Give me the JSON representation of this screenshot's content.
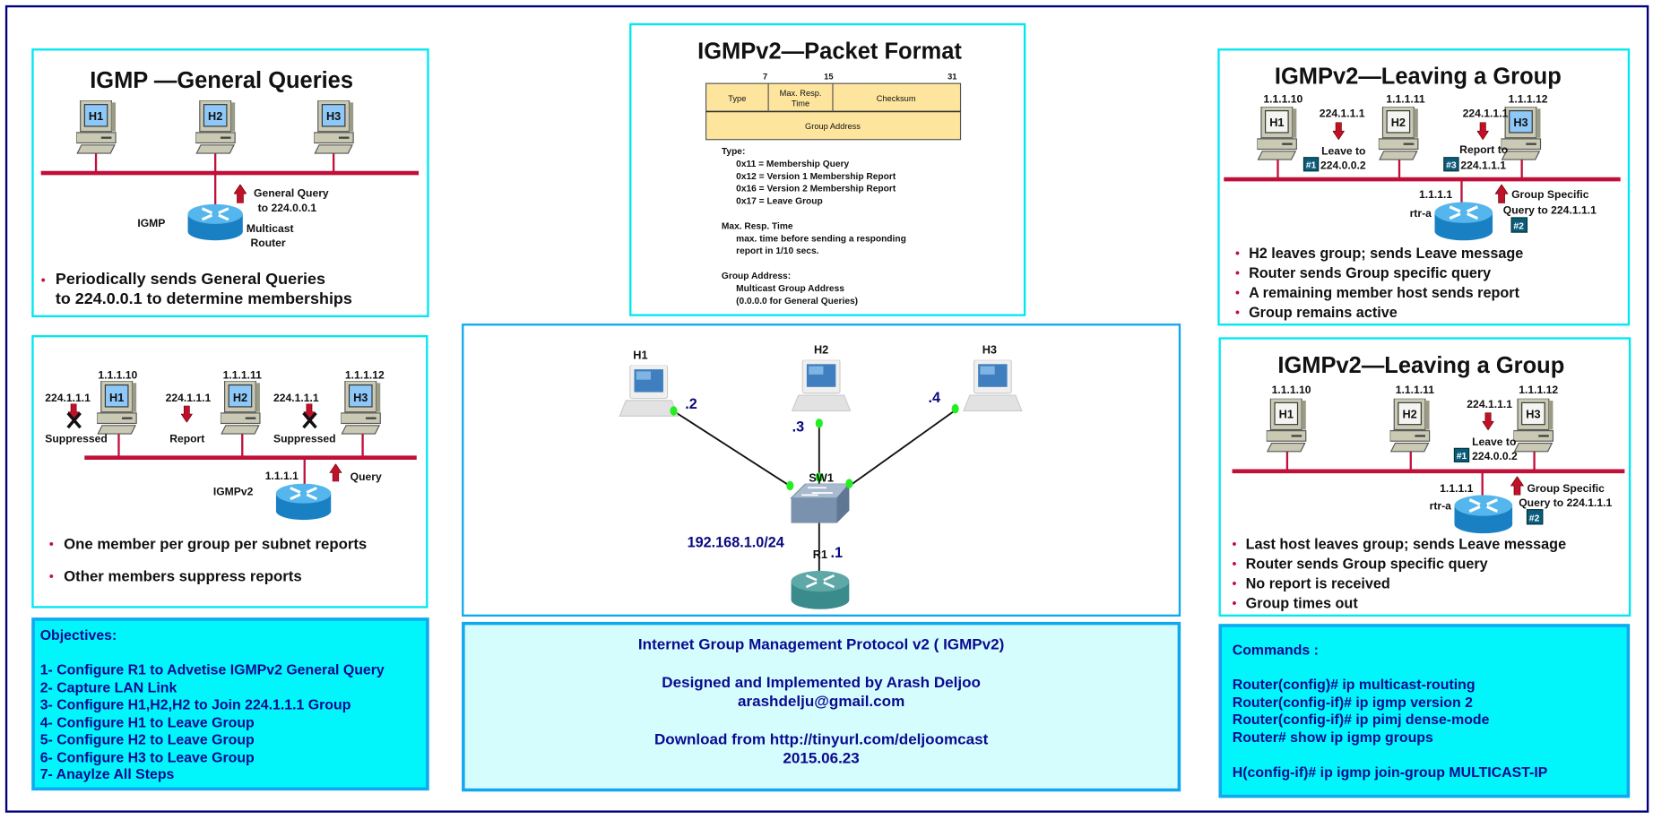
{
  "general_queries": {
    "title": "IGMP  —General Queries",
    "hosts": [
      "H1",
      "H2",
      "H3"
    ],
    "query_label_1": "General Query",
    "query_label_2": "to 224.0.0.1",
    "protocol_label": "IGMP",
    "router_label_1": "Multicast",
    "router_label_2": "Router",
    "bullet_1": "Periodically sends General Queries",
    "bullet_2": "to 224.0.0.1 to determine memberships"
  },
  "suppression": {
    "host_ips": [
      "1.1.1.10",
      "1.1.1.11",
      "1.1.1.12"
    ],
    "hosts": [
      "H1",
      "H2",
      "H3"
    ],
    "group_labels": [
      "224.1.1.1",
      "224.1.1.1",
      "224.1.1.1"
    ],
    "actions": [
      "Suppressed",
      "Report",
      "Suppressed"
    ],
    "router_ip": "1.1.1.1",
    "query_label": "Query",
    "router_label": "IGMPv2",
    "bullets": [
      "One member per group per subnet reports",
      "Other members suppress reports"
    ]
  },
  "objectives": {
    "title": "Objectives:",
    "items": [
      "1- Configure R1 to Advetise IGMPv2 General Query",
      "2- Capture LAN Link",
      "3- Configure H1,H2,H2 to Join 224.1.1.1 Group",
      "4- Configure H1 to Leave Group",
      "5- Configure H2 to Leave Group",
      "6- Configure H3 to Leave Group",
      "7- Anaylze All Steps"
    ]
  },
  "packet_format": {
    "title": "IGMPv2—Packet Format",
    "bit_marks": [
      "7",
      "15",
      "31"
    ],
    "fields": {
      "type": "Type",
      "max_resp_1": "Max. Resp.",
      "max_resp_2": "Time",
      "checksum": "Checksum",
      "group_address": "Group Address"
    },
    "type_heading": "Type:",
    "type_values": [
      "0x11 = Membership Query",
      "0x12 = Version 1 Membership Report",
      "0x16 = Version 2 Membership Report",
      "0x17 = Leave Group"
    ],
    "max_resp_heading": "Max. Resp. Time",
    "max_resp_desc": [
      "max. time before sending a responding",
      "report in 1/10 secs."
    ],
    "group_heading": "Group Address:",
    "group_desc": [
      "Multicast Group Address",
      "(0.0.0.0 for General Queries)"
    ]
  },
  "topology": {
    "hosts": [
      "H1",
      "H2",
      "H3"
    ],
    "host_addrs": [
      ".2",
      ".3",
      ".4"
    ],
    "switch": "SW1",
    "router": "R1",
    "router_addr": ".1",
    "subnet": "192.168.1.0/24",
    "link_status_color": "#22ee22"
  },
  "info": {
    "line_1": "Internet Group Management Protocol v2 ( IGMPv2)",
    "line_2": "Designed and Implemented by Arash Deljoo",
    "line_3": "arashdelju@gmail.com",
    "line_4": "Download from http://tinyurl.com/deljoomcast",
    "line_5": "2015.06.23"
  },
  "leave_1": {
    "title": "IGMPv2—Leaving a Group",
    "host_ips": [
      "1.1.1.10",
      "1.1.1.11",
      "1.1.1.12"
    ],
    "hosts": [
      "H1",
      "H2",
      "H3"
    ],
    "group_a": "224.1.1.1",
    "leave_1": "Leave to",
    "leave_2": "224.0.0.2",
    "group_b": "224.1.1.1",
    "report_1": "Report to",
    "report_2": "224.1.1.1",
    "steps": [
      "#1",
      "#2",
      "#3"
    ],
    "router_ip": "1.1.1.1",
    "router_name": "rtr-a",
    "query_1": "Group Specific",
    "query_2": "Query to 224.1.1.1",
    "bullets": [
      "H2 leaves group; sends Leave message",
      "Router sends Group specific query",
      "A remaining member host sends report",
      "Group remains active"
    ]
  },
  "leave_2": {
    "title": "IGMPv2—Leaving a Group",
    "host_ips": [
      "1.1.1.10",
      "1.1.1.11",
      "1.1.1.12"
    ],
    "hosts": [
      "H1",
      "H2",
      "H3"
    ],
    "group_a": "224.1.1.1",
    "leave_1": "Leave to",
    "leave_2": "224.0.0.2",
    "steps": [
      "#1",
      "#2"
    ],
    "router_ip": "1.1.1.1",
    "router_name": "rtr-a",
    "query_1": "Group Specific",
    "query_2": "Query to 224.1.1.1",
    "bullets": [
      "Last host leaves group; sends Leave message",
      "Router sends Group specific query",
      "No report is received",
      "Group times out"
    ]
  },
  "commands": {
    "title": "Commands :",
    "router": [
      "Router(config)# ip multicast-routing",
      "Router(config-if)# ip igmp version 2",
      "Router(config-if)# ip pimj dense-mode",
      "Router# show ip igmp groups"
    ],
    "host": "H(config-if)# ip igmp join-group MULTICAST-IP"
  },
  "colors": {
    "panel_border": "#00e8f0",
    "box_fill": "#00f6fa",
    "info_fill": "#d6fdfd",
    "text_blue": "#0a0a90",
    "bus_red": "#c0103a",
    "frame": "#000080"
  }
}
